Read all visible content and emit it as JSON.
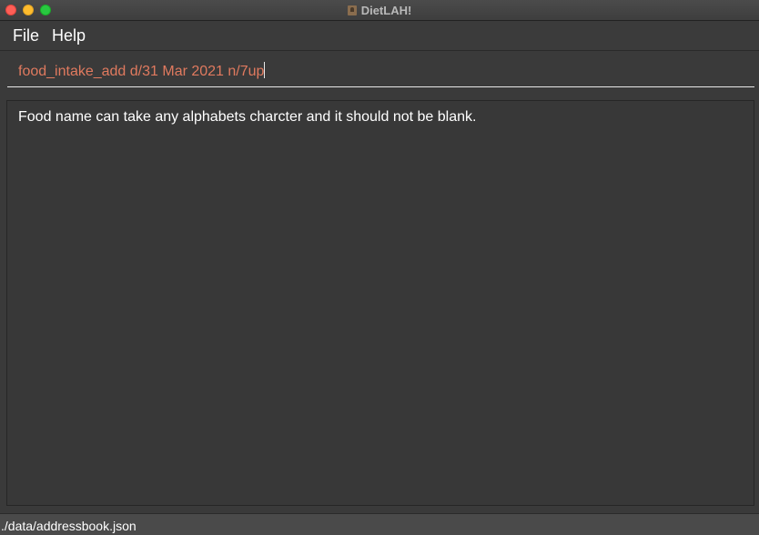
{
  "window": {
    "title": "DietLAH!"
  },
  "menu": {
    "items": [
      {
        "label": "File"
      },
      {
        "label": "Help"
      }
    ]
  },
  "command": {
    "value": "food_intake_add d/31 Mar 2021 n/7up",
    "text_color": "#e07a5f"
  },
  "result": {
    "message": "Food name can take any alphabets charcter and it should not be blank."
  },
  "status": {
    "path": "./data/addressbook.json"
  },
  "colors": {
    "close": "#fe5f57",
    "minimize": "#febc2e",
    "maximize": "#28c840",
    "background": "#3a3a3a"
  }
}
